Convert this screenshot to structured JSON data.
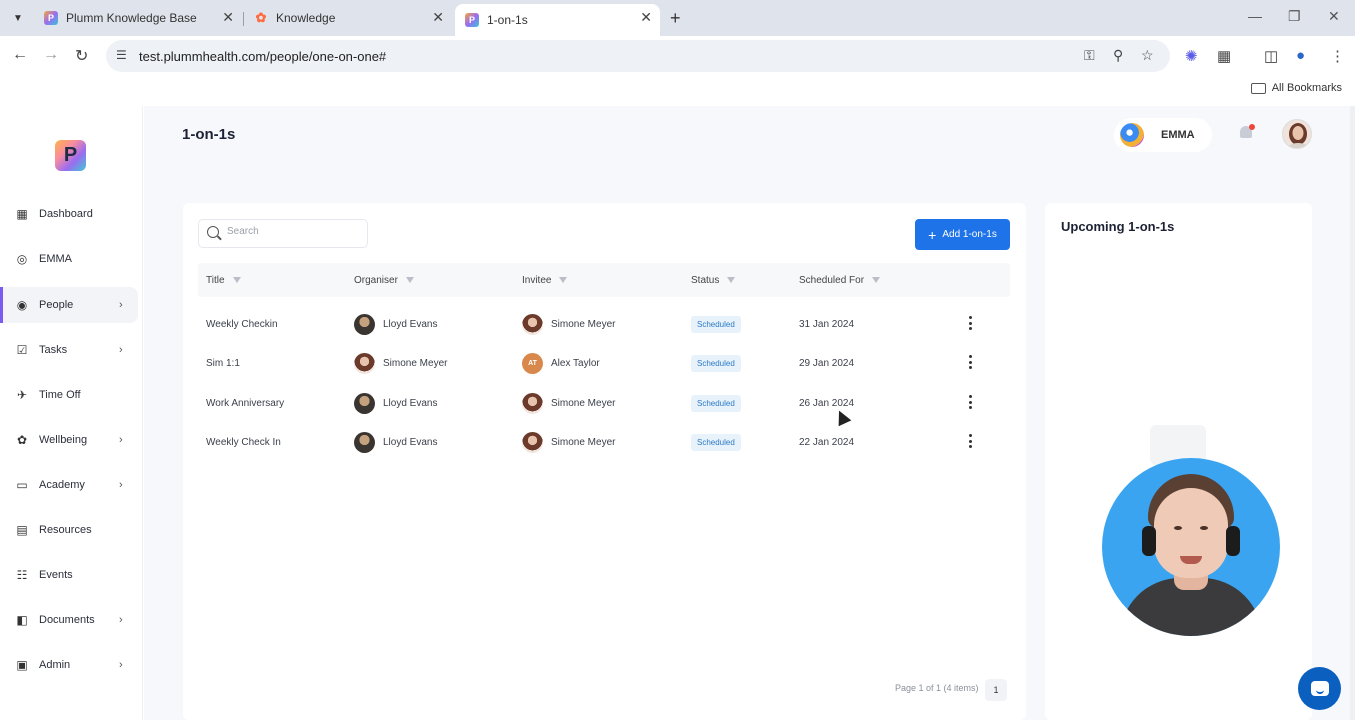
{
  "browser": {
    "tabs": [
      {
        "title": "Plumm Knowledge Base",
        "favicon": "P"
      },
      {
        "title": "Knowledge",
        "favicon": "hubspot-icon"
      },
      {
        "title": "1-on-1s",
        "favicon": "P"
      }
    ],
    "url": "test.plummhealth.com/people/one-on-one#",
    "bookmarks_label": "All Bookmarks"
  },
  "sidebar": {
    "logo_text": "P",
    "items": [
      {
        "label": "Dashboard",
        "icon": "grid-icon",
        "chevron": false
      },
      {
        "label": "EMMA",
        "icon": "emma-icon",
        "chevron": false
      },
      {
        "label": "People",
        "icon": "people-icon",
        "chevron": true
      },
      {
        "label": "Tasks",
        "icon": "tasks-icon",
        "chevron": true
      },
      {
        "label": "Time Off",
        "icon": "plane-icon",
        "chevron": false
      },
      {
        "label": "Wellbeing",
        "icon": "wellbeing-icon",
        "chevron": true
      },
      {
        "label": "Academy",
        "icon": "book-icon",
        "chevron": true
      },
      {
        "label": "Resources",
        "icon": "resources-icon",
        "chevron": false
      },
      {
        "label": "Events",
        "icon": "calendar-icon",
        "chevron": false
      },
      {
        "label": "Documents",
        "icon": "documents-icon",
        "chevron": true
      },
      {
        "label": "Admin",
        "icon": "admin-icon",
        "chevron": true
      }
    ]
  },
  "header": {
    "title": "1-on-1s",
    "emma_label": "EMMA"
  },
  "main": {
    "search_placeholder": "Search",
    "add_button_label": "Add 1-on-1s",
    "columns": [
      "Title",
      "Organiser",
      "Invitee",
      "Status",
      "Scheduled For"
    ],
    "rows": [
      {
        "title": "Weekly Checkin",
        "organiser": "Lloyd Evans",
        "invitee": "Simone Meyer",
        "status": "Scheduled",
        "scheduled_for": "31 Jan 2024"
      },
      {
        "title": "Sim 1:1",
        "organiser": "Simone Meyer",
        "invitee": "Alex Taylor",
        "status": "Scheduled",
        "scheduled_for": "29 Jan 2024"
      },
      {
        "title": "Work Anniversary",
        "organiser": "Lloyd Evans",
        "invitee": "Simone Meyer",
        "status": "Scheduled",
        "scheduled_for": "26 Jan 2024"
      },
      {
        "title": "Weekly Check In",
        "organiser": "Lloyd Evans",
        "invitee": "Simone Meyer",
        "status": "Scheduled",
        "scheduled_for": "22 Jan 2024"
      }
    ],
    "invitee_initials": "AT",
    "pagination_text": "Page 1 of 1 (4 items)",
    "current_page": "1"
  },
  "upcoming": {
    "title": "Upcoming 1-on-1s"
  },
  "colors": {
    "primary": "#1e73e8",
    "status_badge_bg": "#e7f2fb",
    "status_badge_text": "#2d7ac6",
    "active_indicator": "#7b5cf0"
  }
}
